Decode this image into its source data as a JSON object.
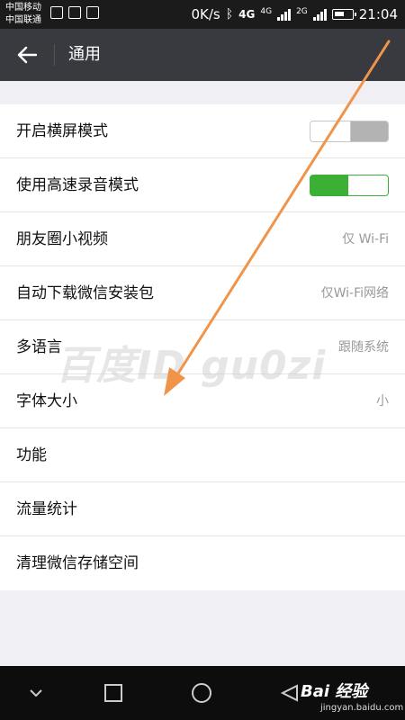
{
  "status_bar": {
    "carrier_1": "中国移动",
    "carrier_2": "中国联通",
    "speed": "0K/s",
    "network_type": "4G",
    "network_small_1": "4G",
    "network_small_2": "2G",
    "time": "21:04"
  },
  "header": {
    "title": "通用",
    "background": "#393a3f"
  },
  "settings": [
    {
      "label": "开启横屏模式",
      "toggle": "off"
    },
    {
      "label": "使用高速录音模式",
      "toggle": "on"
    },
    {
      "label": "朋友圈小视频",
      "value": "仅 Wi-Fi"
    },
    {
      "label": "自动下载微信安装包",
      "value": "仅Wi-Fi网络"
    },
    {
      "label": "多语言",
      "value": "跟随系统"
    },
    {
      "label": "字体大小",
      "value": "小"
    },
    {
      "label": "功能"
    },
    {
      "label": "流量统计"
    },
    {
      "label": "清理微信存储空间"
    }
  ],
  "colors": {
    "toggle_on": "#3cb034",
    "annotation_arrow": "#f0944a"
  },
  "watermark": {
    "text": "百度ID gu0zi"
  },
  "footer": {
    "logo_text": "Bai 经验",
    "logo_sub": "jingyan.baidu.com"
  }
}
